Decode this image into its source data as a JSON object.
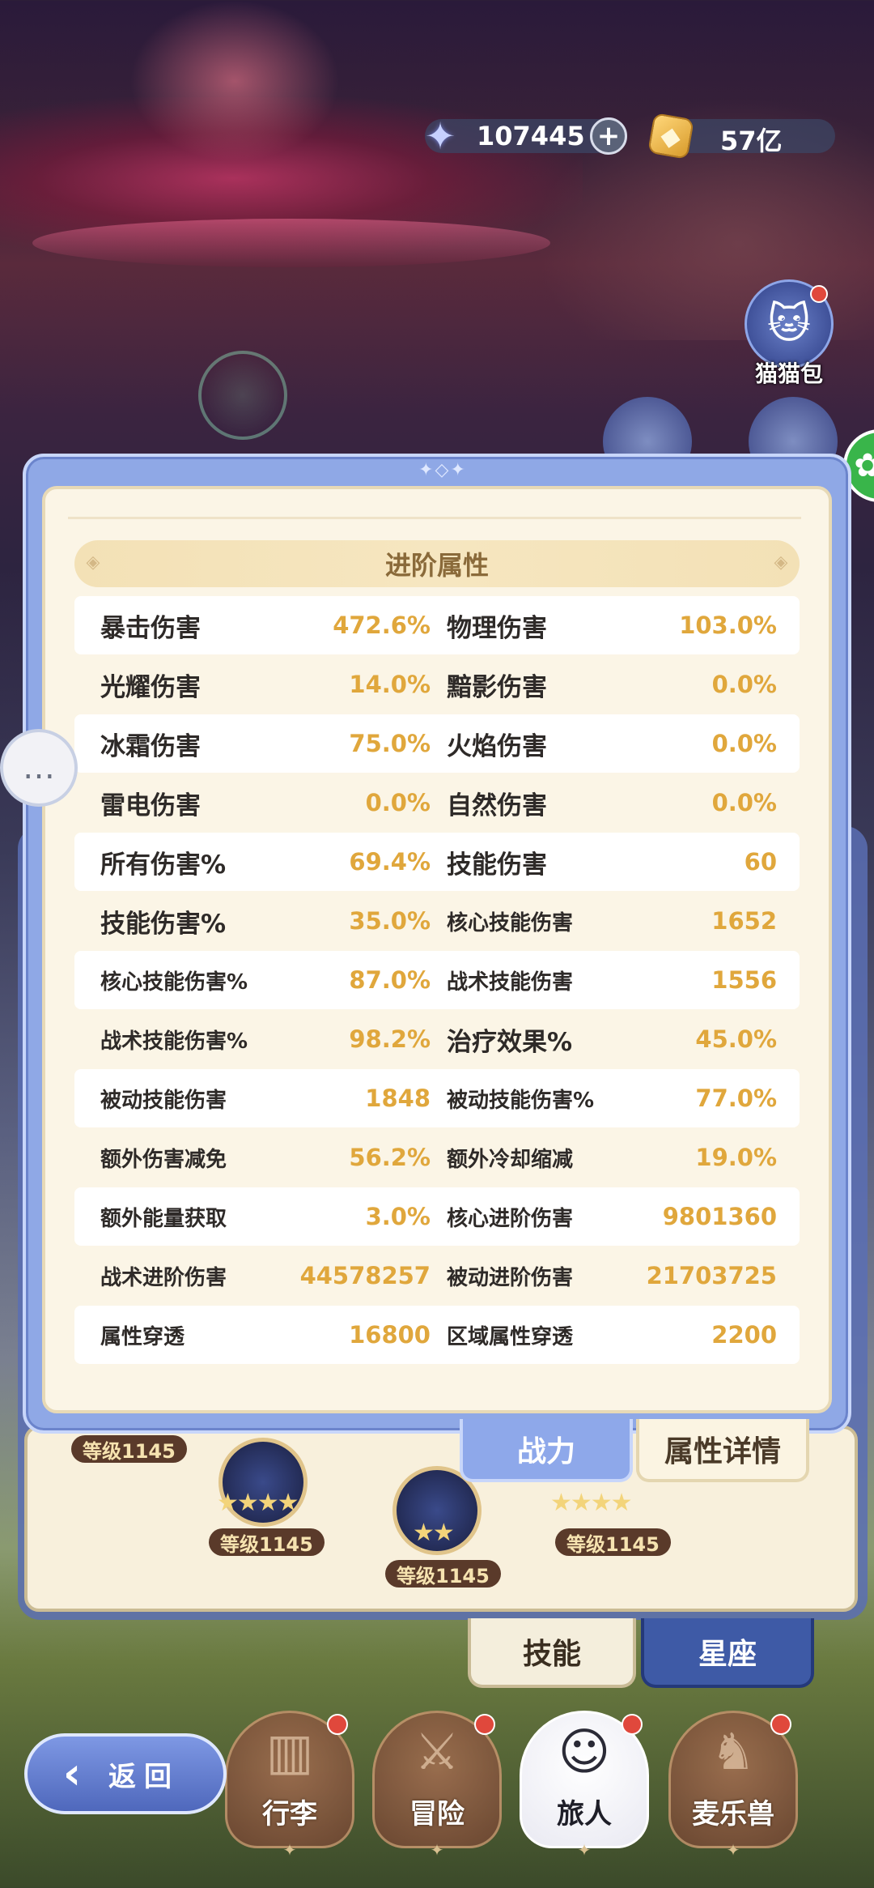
{
  "currency": {
    "stars": {
      "icon": "star-crystal-icon",
      "value": "107445"
    },
    "gold": {
      "icon": "gold-coin-icon",
      "value": "57亿"
    }
  },
  "side": {
    "cat_bag_label": "猫猫包"
  },
  "panel": {
    "section_title": "进阶属性",
    "stats": [
      {
        "l1": "暴击伤害",
        "v1": "472.6%",
        "l2": "物理伤害",
        "v2": "103.0%"
      },
      {
        "l1": "光耀伤害",
        "v1": "14.0%",
        "l2": "黯影伤害",
        "v2": "0.0%"
      },
      {
        "l1": "冰霜伤害",
        "v1": "75.0%",
        "l2": "火焰伤害",
        "v2": "0.0%"
      },
      {
        "l1": "雷电伤害",
        "v1": "0.0%",
        "l2": "自然伤害",
        "v2": "0.0%"
      },
      {
        "l1": "所有伤害%",
        "v1": "69.4%",
        "l2": "技能伤害",
        "v2": "60"
      },
      {
        "l1": "技能伤害%",
        "v1": "35.0%",
        "l2": "核心技能伤害",
        "v2": "1652"
      },
      {
        "l1": "核心技能伤害%",
        "v1": "87.0%",
        "l2": "战术技能伤害",
        "v2": "1556"
      },
      {
        "l1": "战术技能伤害%",
        "v1": "98.2%",
        "l2": "治疗效果%",
        "v2": "45.0%"
      },
      {
        "l1": "被动技能伤害",
        "v1": "1848",
        "l2": "被动技能伤害%",
        "v2": "77.0%"
      },
      {
        "l1": "额外伤害减免",
        "v1": "56.2%",
        "l2": "额外冷却缩减",
        "v2": "19.0%"
      },
      {
        "l1": "额外能量获取",
        "v1": "3.0%",
        "l2": "核心进阶伤害",
        "v2": "9801360"
      },
      {
        "l1": "战术进阶伤害",
        "v1": "44578257",
        "l2": "被动进阶伤害",
        "v2": "21703725"
      },
      {
        "l1": "属性穿透",
        "v1": "16800",
        "l2": "区域属性穿透",
        "v2": "2200"
      }
    ],
    "tabs": {
      "power": "战力",
      "details": "属性详情"
    }
  },
  "tree": {
    "levels": [
      "等级1145",
      "等级1145",
      "等级1145",
      "等级1145"
    ]
  },
  "lower_tabs": {
    "skill": "技能",
    "constellation": "星座"
  },
  "back": {
    "label": "返回"
  },
  "nav": [
    {
      "label": "行李",
      "icon": "luggage-icon"
    },
    {
      "label": "冒险",
      "icon": "crossed-swords-icon"
    },
    {
      "label": "旅人",
      "icon": "traveler-avatar-icon"
    },
    {
      "label": "麦乐兽",
      "icon": "fox-pet-icon"
    }
  ]
}
